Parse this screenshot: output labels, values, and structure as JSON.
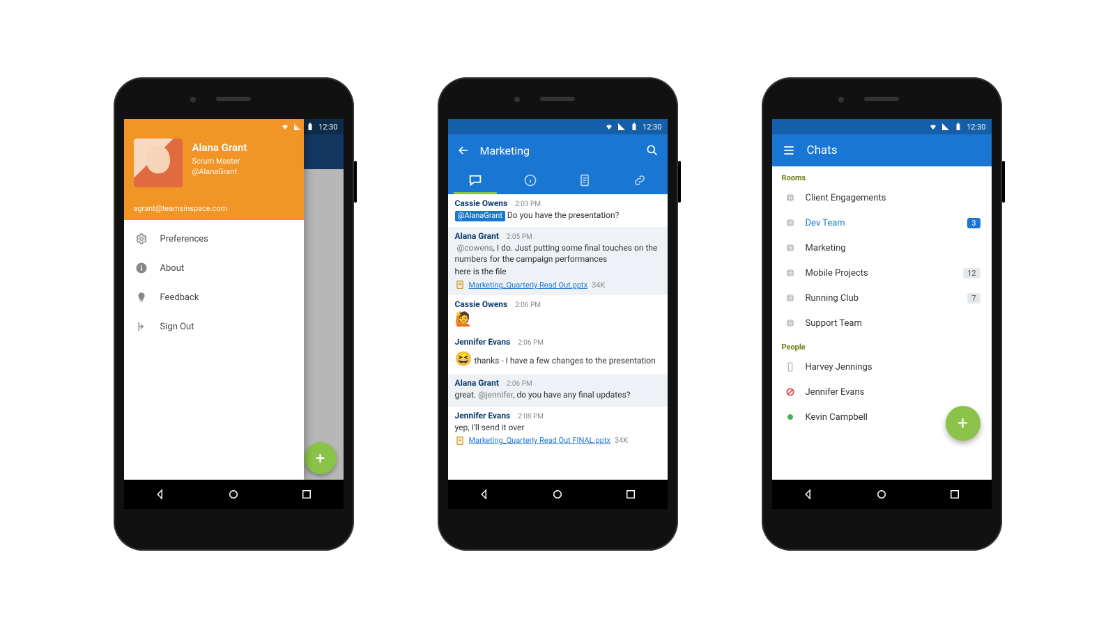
{
  "status": {
    "time": "12:30"
  },
  "drawer": {
    "name": "Alana Grant",
    "role": "Scrum Master",
    "handle": "@AlanaGrant",
    "email": "agrant@teamsinspace.com",
    "items": [
      {
        "label": "Preferences"
      },
      {
        "label": "About"
      },
      {
        "label": "Feedback"
      },
      {
        "label": "Sign Out"
      }
    ]
  },
  "chat": {
    "title": "Marketing",
    "tabs": [
      "chat",
      "info",
      "notes",
      "links"
    ],
    "messages": [
      {
        "sender": "Cassie Owens",
        "time": "2:03 PM",
        "mention_chip": "@AlanaGrant",
        "body_after_chip": "Do you have the presentation?"
      },
      {
        "sender": "Alana Grant",
        "time": "2:05 PM",
        "mention_inline": "@cowens",
        "body_after_inline": ", I do. Just putting some final touches on the numbers for the campaign performances",
        "body2": "here is the file",
        "file_name": "Marketing_Quarterly Read Out.pptx",
        "file_size": "34K"
      },
      {
        "sender": "Cassie Owens",
        "time": "2:06 PM",
        "emoji": "🙋"
      },
      {
        "sender": "Jennifer Evans",
        "time": "2:06 PM",
        "emoji": "😆",
        "body_after_emoji": "thanks - I have a few changes to the presentation"
      },
      {
        "sender": "Alana Grant",
        "time": "2:06 PM",
        "body_prefix": "great. ",
        "mention_inline": "@jennifer",
        "body_after_inline": ", do you have any final updates?"
      },
      {
        "sender": "Jennifer Evans",
        "time": "2:08 PM",
        "body": "yep, I'll send it over",
        "file_name": "Marketing_Quarterly Read Out FINAL.pptx",
        "file_size": "34K"
      }
    ]
  },
  "chats": {
    "title": "Chats",
    "rooms_label": "Rooms",
    "people_label": "People",
    "rooms": [
      {
        "name": "Client Engagements"
      },
      {
        "name": "Dev Team",
        "badge": "3",
        "selected": true
      },
      {
        "name": "Marketing"
      },
      {
        "name": "Mobile Projects",
        "badge": "12"
      },
      {
        "name": "Running Club",
        "badge": "7"
      },
      {
        "name": "Support Team"
      }
    ],
    "people": [
      {
        "name": "Harvey Jennings",
        "status": "mobile"
      },
      {
        "name": "Jennifer Evans",
        "status": "dnd"
      },
      {
        "name": "Kevin Campbell",
        "status": "online"
      }
    ]
  }
}
